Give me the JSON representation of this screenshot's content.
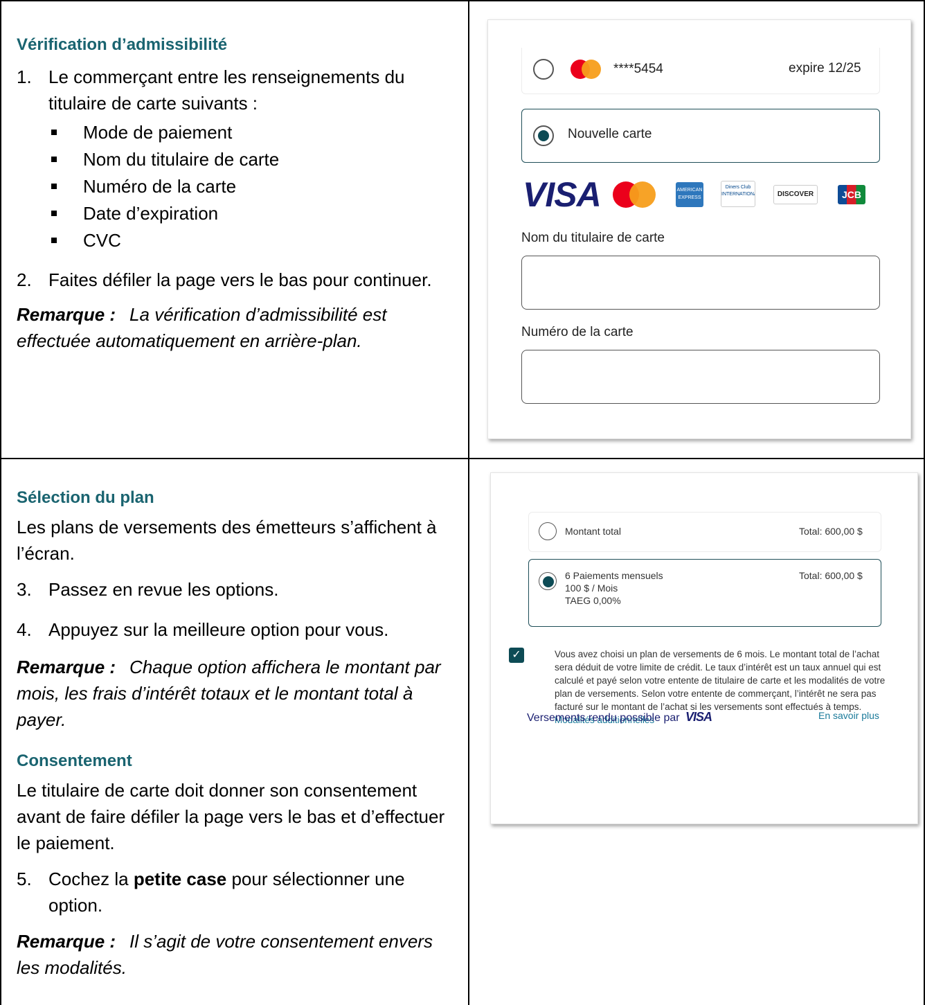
{
  "section1": {
    "title": "Vérification d’admissibilité",
    "step1_num": "1.",
    "step1_text": "Le commerçant entre les renseignements du titulaire de carte suivants :",
    "fields": [
      "Mode de paiement",
      "Nom du titulaire de carte",
      "Numéro de la carte",
      "Date d’expiration",
      "CVC"
    ],
    "step2_num": "2.",
    "step2_text": "Faites défiler la page vers le bas pour continuer.",
    "note_label": "Remarque :",
    "note_text": "La vérification d’admissibilité est effectuée automatiquement en arrière-plan."
  },
  "card_form": {
    "saved_card_number": "****5454",
    "saved_card_expiry": "expire 12/25",
    "new_card_label": "Nouvelle carte",
    "brands": [
      "VISA",
      "Mastercard",
      "AMERICAN EXPRESS",
      "Diners Club INTERNATIONAL",
      "DISCOVER",
      "JCB"
    ],
    "name_label": "Nom du titulaire de carte",
    "name_value": "",
    "number_label": "Numéro de la carte",
    "number_value": ""
  },
  "section2": {
    "title": "Sélection du plan",
    "intro": "Les plans de versements des émetteurs s’affichent à l’écran.",
    "step3_num": "3.",
    "step3_text": "Passez en revue les options.",
    "step4_num": "4.",
    "step4_text": "Appuyez sur la meilleure option pour vous.",
    "note_label": "Remarque :",
    "note_text": "Chaque option affichera le montant par mois, les frais d’intérêt totaux et le montant total à payer."
  },
  "section3": {
    "title": "Consentement",
    "intro": "Le titulaire de carte doit donner son consentement avant de faire défiler la page vers le bas et d’effectuer le paiement.",
    "step5_num": "5.",
    "step5_before": "Cochez la ",
    "step5_bold": "petite case",
    "step5_after": " pour sélectionner une option.",
    "note_label": "Remarque :",
    "note_text": "Il s’agit de votre consentement envers les modalités."
  },
  "plan_form": {
    "option1_label": "Montant total",
    "option1_total": "Total: 600,00 $",
    "option2_label": "6 Paiements mensuels",
    "option2_monthly": "100 $ / Mois",
    "option2_taeg": "TAEG 0,00%",
    "option2_total": "Total: 600,00 $",
    "consent_text": "Vous avez choisi un plan de versements de 6 mois. Le montant total de l’achat sera déduit de votre limite de crédit. Le taux d’intérêt est un taux annuel qui est calculé et payé selon votre entente de titulaire de carte et les modalités de votre plan de versements. Selon votre entente de commerçant, l’intérêt ne sera pas facturé sur le montant de l’achat si les versements sont effectués à temps.",
    "consent_link": "Modalités additionnelles",
    "footer_text": "Versements rendu possible par",
    "footer_brand": "VISA",
    "learn_more": "En savoir plus"
  }
}
